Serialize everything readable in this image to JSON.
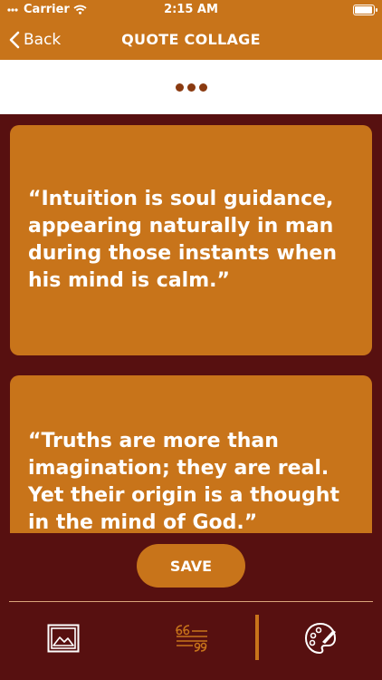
{
  "status_bar": {
    "carrier": "Carrier",
    "time": "2:15 AM"
  },
  "nav": {
    "back_label": "Back",
    "title": "QUOTE COLLAGE"
  },
  "quotes": [
    "“Intuition is soul guidance, appearing naturally in man during those instants when his mind is calm.”",
    "“Truths are more than imagination; they are real. Yet their origin is a thought in the mind of God.”"
  ],
  "actions": {
    "save_label": "SAVE"
  },
  "toolbar": {
    "icons": [
      "image-icon",
      "quote-text-icon",
      "palette-icon"
    ]
  },
  "colors": {
    "accent": "#c8741a",
    "background": "#571010",
    "strip": "#ffffff",
    "dots": "#8a3a10"
  }
}
